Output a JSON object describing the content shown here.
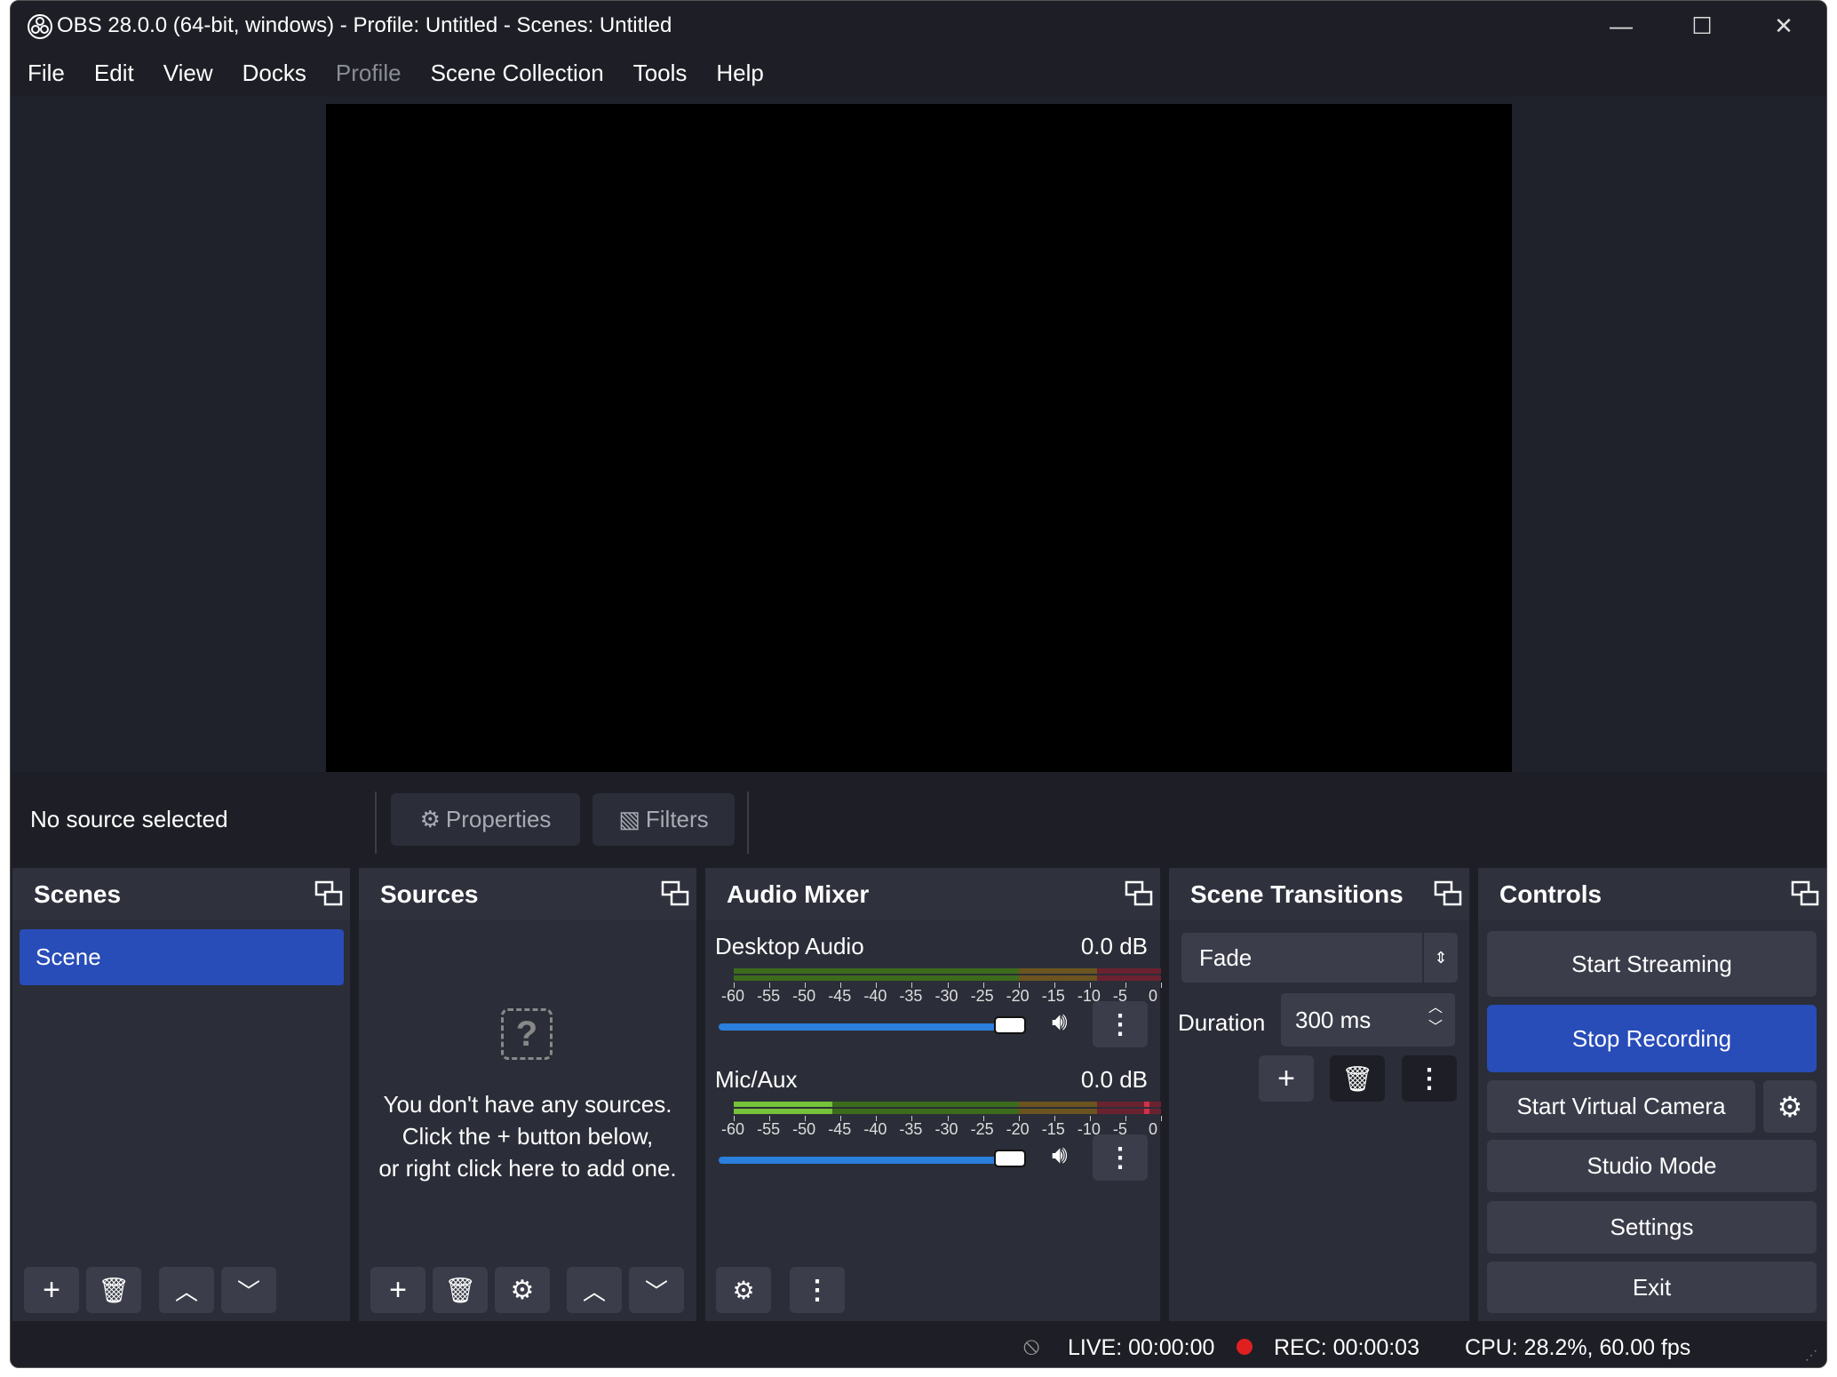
{
  "window": {
    "title": "OBS 28.0.0 (64-bit, windows) - Profile: Untitled - Scenes: Untitled"
  },
  "menu": [
    "File",
    "Edit",
    "View",
    "Docks",
    "Profile",
    "Scene Collection",
    "Tools",
    "Help"
  ],
  "source_toolbar": {
    "status": "No source selected",
    "properties": "Properties",
    "filters": "Filters"
  },
  "scenes": {
    "title": "Scenes",
    "items": [
      "Scene"
    ]
  },
  "sources": {
    "title": "Sources",
    "empty": [
      "You don't have any sources.",
      "Click the + button below,",
      "or right click here to add one."
    ]
  },
  "audio": {
    "title": "Audio Mixer",
    "channels": [
      {
        "name": "Desktop Audio",
        "db": "0.0 dB",
        "volume": 1.0
      },
      {
        "name": "Mic/Aux",
        "db": "0.0 dB",
        "volume": 1.0
      }
    ],
    "ticks": [
      "-60",
      "-55",
      "-50",
      "-45",
      "-40",
      "-35",
      "-30",
      "-25",
      "-20",
      "-15",
      "-10",
      "-5",
      "0"
    ]
  },
  "transitions": {
    "title": "Scene Transitions",
    "selected": "Fade",
    "duration_label": "Duration",
    "duration": "300 ms"
  },
  "controls": {
    "title": "Controls",
    "start_streaming": "Start Streaming",
    "stop_recording": "Stop Recording",
    "virtual_camera": "Start Virtual Camera",
    "studio_mode": "Studio Mode",
    "settings": "Settings",
    "exit": "Exit"
  },
  "status": {
    "live": "LIVE: 00:00:00",
    "rec": "REC: 00:00:03",
    "cpu": "CPU: 28.2%, 60.00 fps"
  },
  "colors": {
    "accent": "#284cb8",
    "rec": "#e02020"
  }
}
